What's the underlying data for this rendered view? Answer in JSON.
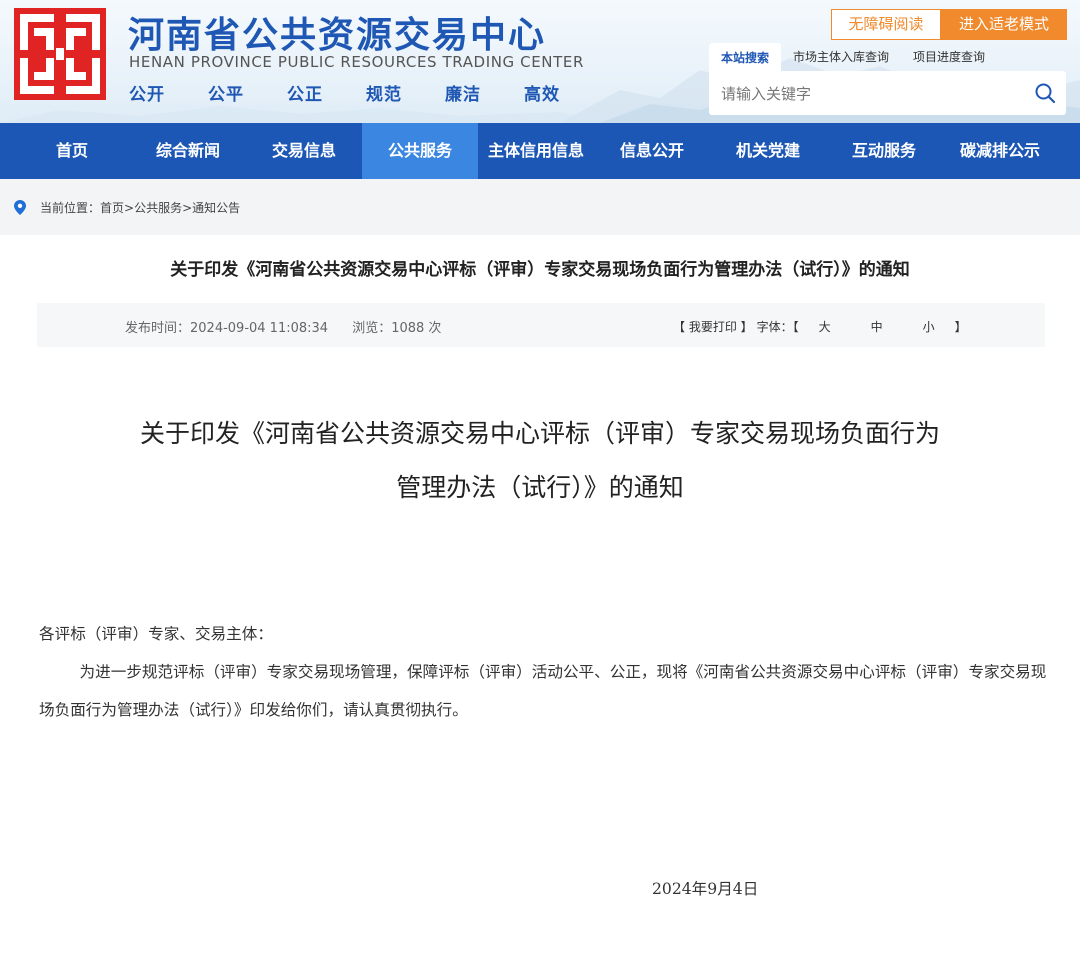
{
  "header": {
    "title": "河南省公共资源交易中心",
    "subtitle": "HENAN PROVINCE PUBLIC RESOURCES TRADING CENTER",
    "slogans": [
      "公开",
      "公平",
      "公正",
      "规范",
      "廉洁",
      "高效"
    ],
    "accessibility_label": "无障碍阅读",
    "elder_mode_label": "进入适老模式",
    "brand_color": "#1f57b4",
    "accent_color": "#f08a2c"
  },
  "search": {
    "tabs": [
      "本站搜索",
      "市场主体入库查询",
      "项目进度查询"
    ],
    "placeholder": "请输入关键字",
    "icon": "search-icon"
  },
  "nav": {
    "items": [
      "首页",
      "综合新闻",
      "交易信息",
      "公共服务",
      "主体信用信息",
      "信息公开",
      "机关党建",
      "互动服务",
      "碳减排公示"
    ],
    "active_index": 3,
    "bg_color": "#1d57b5",
    "active_color": "#3b86e0"
  },
  "breadcrumb": {
    "label": "当前位置：",
    "items": [
      "首页",
      "公共服务",
      "通知公告"
    ]
  },
  "article": {
    "title": "关于印发《河南省公共资源交易中心评标（评审）专家交易现场负面行为管理办法（试行）》的通知",
    "publish_label": "发布时间：2024-09-04 11:08:34",
    "views_label": "浏览：1088 次",
    "print_label": "【 我要打印 】",
    "font_label": "字体：【",
    "font_close": "】",
    "font_sizes": [
      "大",
      "中",
      "小"
    ],
    "heading_line1": "关于印发《河南省公共资源交易中心评标（评审）专家交易现场负面行为",
    "heading_line2": "管理办法（试行）》的通知",
    "salutation": "各评标（评审）专家、交易主体：",
    "body": "为进一步规范评标（评审）专家交易现场管理，保障评标（评审）活动公平、公正，现将《河南省公共资源交易中心评标（评审）专家交易现场负面行为管理办法（试行）》印发给你们，请认真贯彻执行。",
    "date": "2024年9月4日"
  }
}
